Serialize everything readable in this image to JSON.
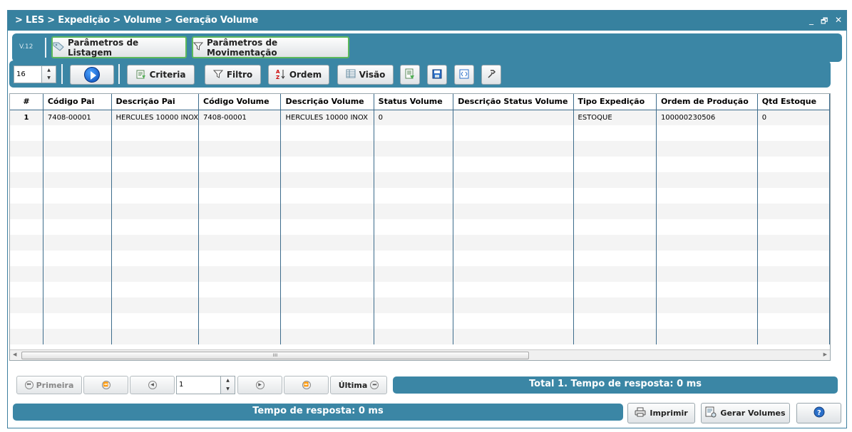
{
  "window": {
    "breadcrumb": "> LES > Expedição > Volume > Geração Volume",
    "minimize_label": "_",
    "restore_label": "🗗",
    "close_label": "✕"
  },
  "top_bar": {
    "version": "V.12",
    "listing_params_label": "Parâmetros de Listagem",
    "movement_params_label": "Parâmetros de Movimentação"
  },
  "toolbar": {
    "page_size_value": "16",
    "criteria_label": "Criteria",
    "filter_label": "Filtro",
    "order_label": "Ordem",
    "view_label": "Visão"
  },
  "grid": {
    "columns": [
      "#",
      "Código Pai",
      "Descrição Pai",
      "Código Volume",
      "Descrição Volume",
      "Status Volume",
      "Descrição Status Volume",
      "Tipo Expedição",
      "Ordem de Produção",
      "Qtd Estoque"
    ],
    "rows": [
      [
        "1",
        "7408-00001",
        "HERCULES 10000 INOX",
        "7408-00001",
        "HERCULES 10000 INOX",
        "0",
        "",
        "ESTOQUE",
        "100000230506",
        "0"
      ]
    ],
    "scroll_grip": "IIII"
  },
  "pagination": {
    "first_label": "Primeira",
    "last_label": "Última",
    "page_value": "1",
    "summary": "Total 1. Tempo de resposta: 0 ms"
  },
  "footer": {
    "response_time": "Tempo de resposta: 0 ms",
    "print_label": "Imprimir",
    "generate_label": "Gerar Volumes"
  }
}
